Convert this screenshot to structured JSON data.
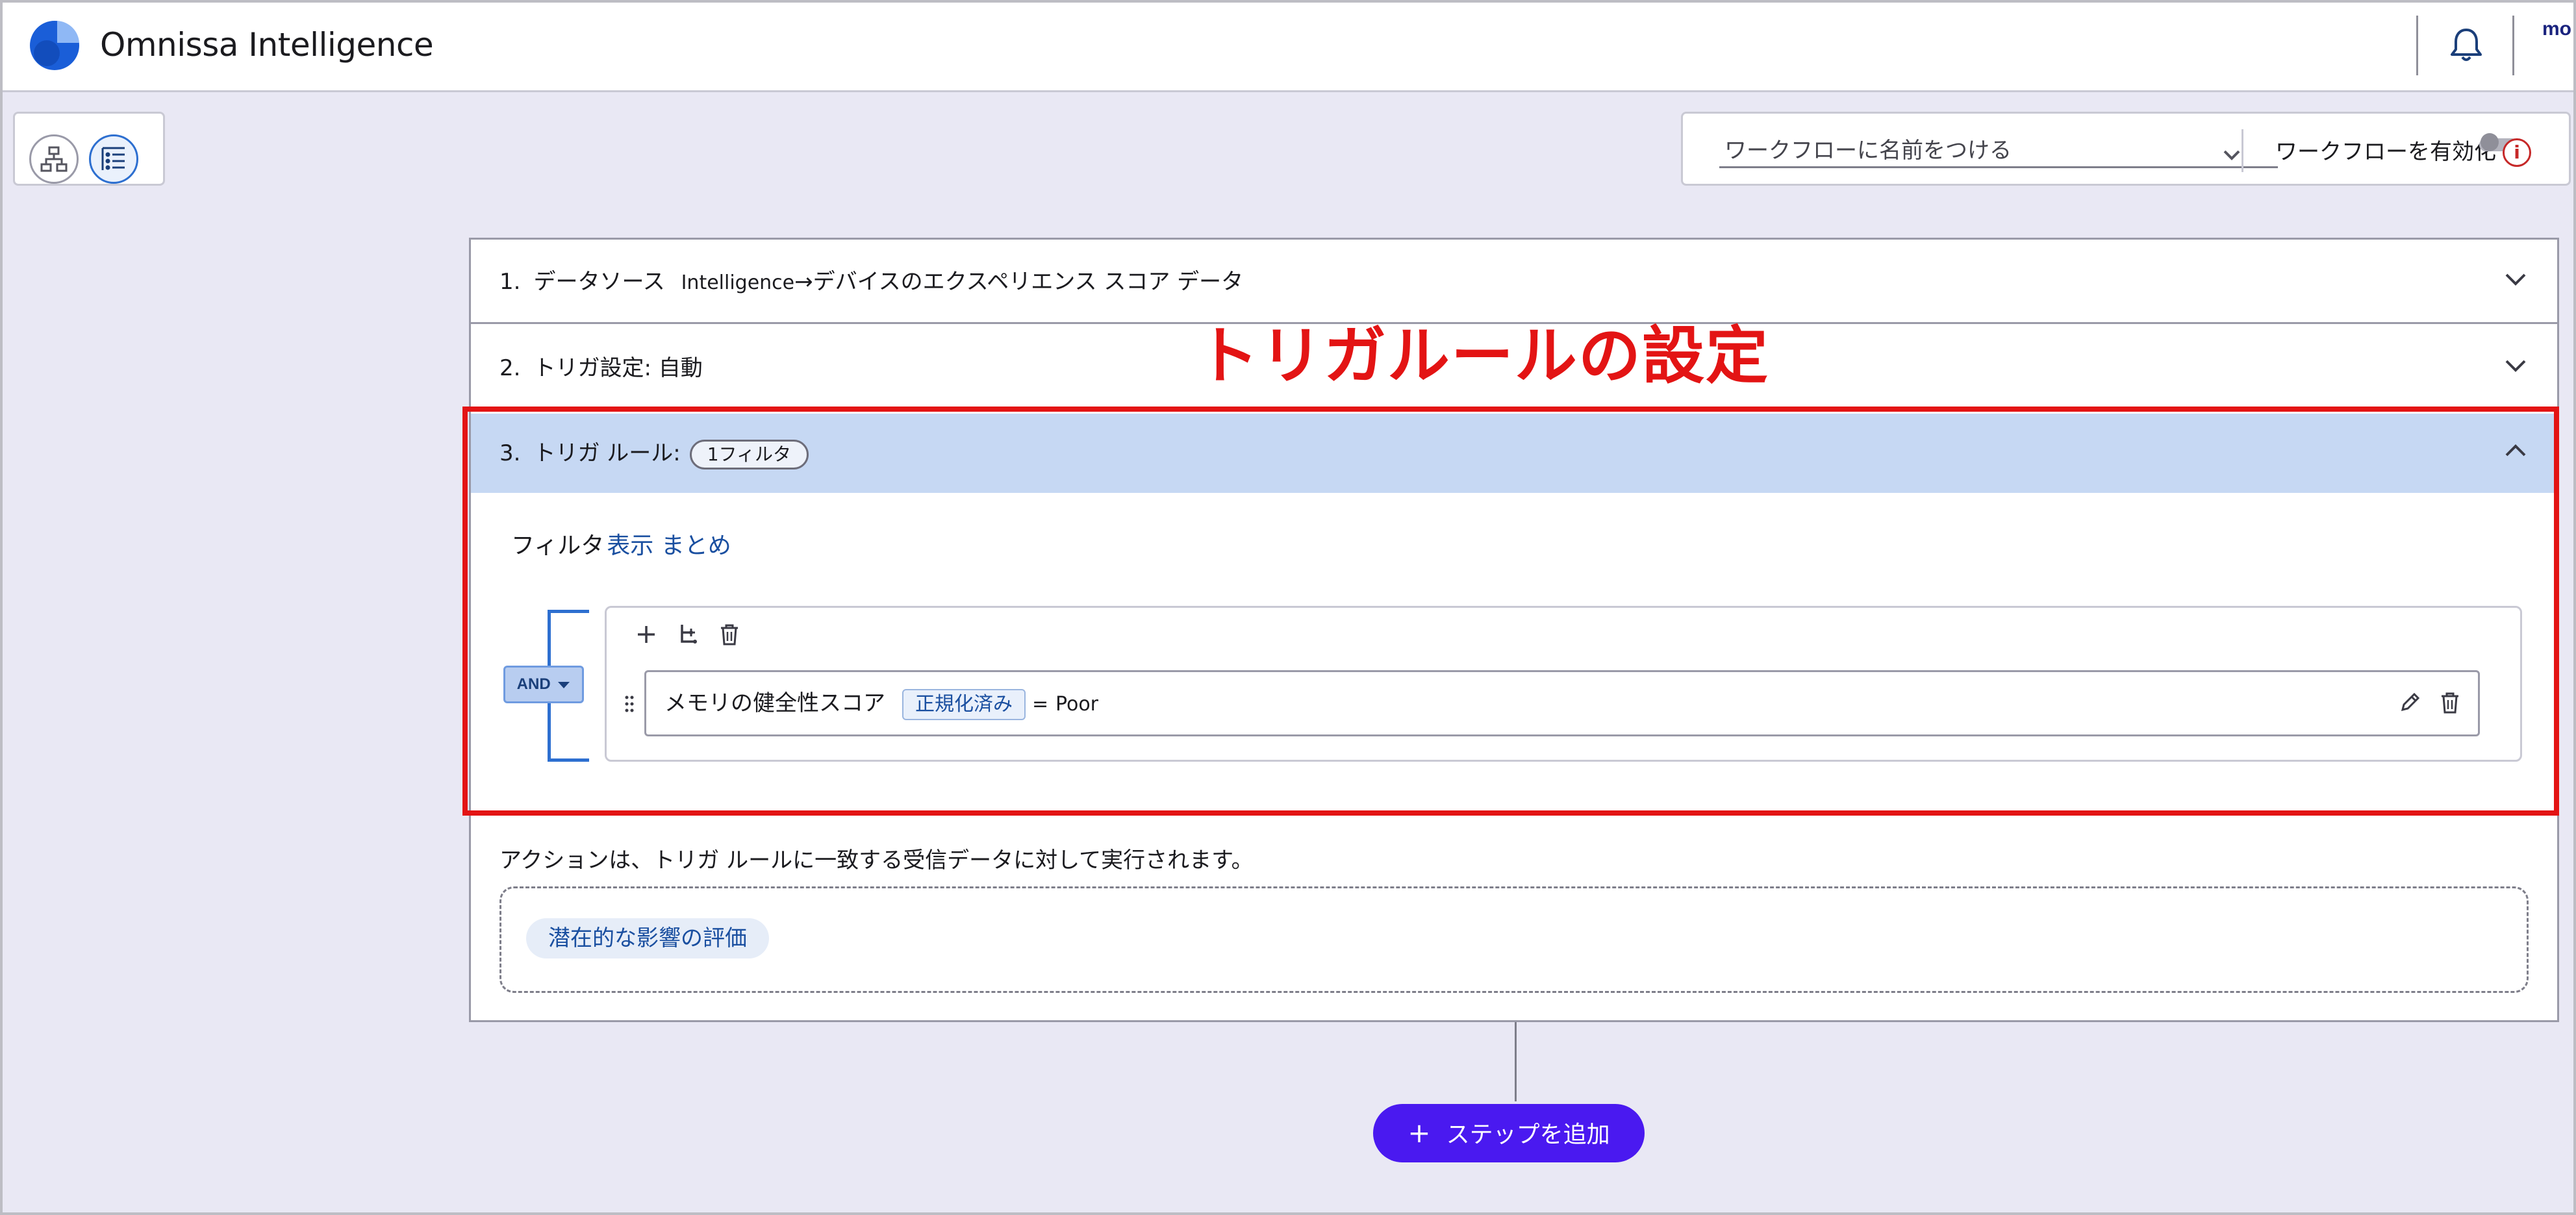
{
  "header": {
    "app_title": "Omnissa Intelligence",
    "user_abbr": "mo",
    "bell_icon": "bell-icon"
  },
  "view_toggle": {
    "items": [
      {
        "icon": "org-chart-icon",
        "active": false
      },
      {
        "icon": "list-view-icon",
        "active": true
      }
    ]
  },
  "workflow": {
    "name_placeholder": "ワークフローに名前をつける",
    "enable_label": "ワークフローを有効化",
    "enabled": false
  },
  "steps": [
    {
      "num": "1.",
      "label": "データソース",
      "source": "Intelligence",
      "arrow": "→",
      "target": "デバイスのエクスペリエンス スコア データ"
    },
    {
      "num": "2.",
      "label": "トリガ設定: 自動"
    },
    {
      "num": "3.",
      "label": "トリガ ルール:",
      "badge": "1フィルタ"
    }
  ],
  "filter": {
    "label": "フィルタ",
    "link": "表示 まとめ",
    "operator": "AND",
    "rule": {
      "field": "メモリの健全性スコア",
      "tag": "正規化済み",
      "op": "=",
      "value": "Poor"
    }
  },
  "action": {
    "description": "アクションは、トリガ ルールに一致する受信データに対して実行されます。",
    "chip": "潜在的な影響の評価"
  },
  "annotation": {
    "label": "トリガルールの設定",
    "color": "#e31414"
  },
  "add_step": {
    "plus": "+",
    "label": "ステップを追加"
  },
  "colors": {
    "accent": "#4a19f0",
    "link": "#1a4fa0",
    "selected_step": "#c6d8f3"
  }
}
